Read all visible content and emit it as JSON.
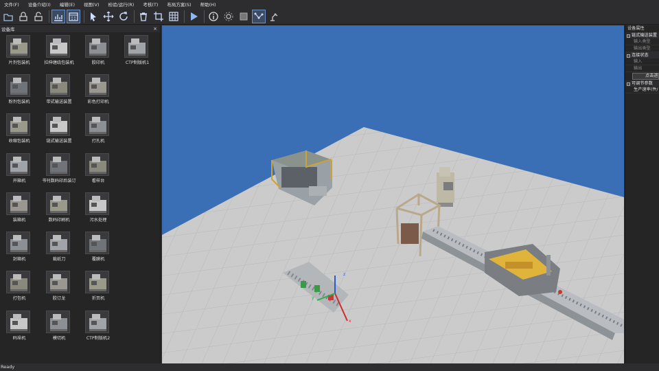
{
  "menu": [
    "文件(F)",
    "设备介绍(I)",
    "编辑(E)",
    "视图(V)",
    "检验/运行(R)",
    "考核(T)",
    "布局方案(S)",
    "帮助(H)"
  ],
  "toolbar": [
    {
      "icon": "open-folder-icon"
    },
    {
      "icon": "lock-icon"
    },
    {
      "icon": "unlock-icon"
    },
    {
      "icon": "chart-icon",
      "active": true
    },
    {
      "icon": "calendar-icon",
      "active": true
    },
    {
      "icon": "select-arrow-icon"
    },
    {
      "icon": "move-icon"
    },
    {
      "icon": "rotate-icon"
    },
    {
      "icon": "delete-icon"
    },
    {
      "icon": "crop-icon"
    },
    {
      "icon": "grid-icon"
    },
    {
      "icon": "play-icon"
    },
    {
      "icon": "info-icon"
    },
    {
      "icon": "gear-icon"
    },
    {
      "icon": "stop-icon"
    },
    {
      "icon": "path-icon",
      "active": true
    },
    {
      "icon": "robot-arm-icon"
    }
  ],
  "device_panel": {
    "title": "设备库",
    "close": "×",
    "items": [
      "片剂包装机",
      "拉伸缠绕包装机",
      "胶印机",
      "CTP制版机1",
      "粉剂包装机",
      "带式输送装置",
      "彩色打印机",
      "收缩包装机",
      "链式输送装置",
      "打孔机",
      "开箱机",
      "书刊数码印后装订",
      "看样台",
      "装箱机",
      "数码印刷机",
      "污水处理",
      "封箱机",
      "裁纸刀",
      "覆膜机",
      "打包机",
      "胶订龙",
      "折页机",
      "码垛机",
      "模切机",
      "CTP制版机2"
    ]
  },
  "props_panel": {
    "title": "设备属性",
    "groups": [
      {
        "label": "链式输送装置",
        "rows": [
          {
            "label": "输入类型",
            "bright": false
          },
          {
            "label": "输出类型",
            "bright": false
          }
        ]
      },
      {
        "label": "连接状态",
        "rows": [
          {
            "label": "输入",
            "bright": false
          },
          {
            "label": "输出",
            "bright": false
          }
        ],
        "button": "点击进"
      },
      {
        "label": "可调节参数",
        "rows": [
          {
            "label": "生产速率(件/",
            "bright": true
          }
        ]
      }
    ]
  },
  "viewport": {
    "sky_color": "#3a6eb5",
    "floor_color": "#c9c9c9",
    "gizmo_labels": [
      "z",
      "y",
      "x"
    ]
  },
  "status": "Ready"
}
